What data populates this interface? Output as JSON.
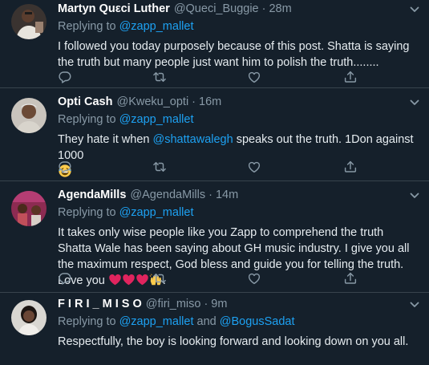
{
  "colors": {
    "background": "#15202b",
    "divider": "#38444d",
    "muted": "#8899a6",
    "link": "#1da1f2",
    "heart": "#e0245e"
  },
  "icons": {
    "actions": [
      "reply-icon",
      "retweet-icon",
      "like-icon",
      "share-icon"
    ],
    "menu": "chevron-down-icon"
  },
  "tweets": [
    {
      "name": "Martyn Quεci Luther",
      "handle": "@Queci_Buggie",
      "time": "28m",
      "replying_prefix": "Replying to",
      "reply_to_1": "@zapp_mallet",
      "text": "I followed you today purposely because of this post. Shatta is saying the truth but many people just want him to polish the truth........"
    },
    {
      "name": "Opti Cash",
      "handle": "@Kweku_opti",
      "time": "16m",
      "replying_prefix": "Replying to",
      "reply_to_1": "@zapp_mallet",
      "text_before": "They hate it when ",
      "mention": "@shattawalegh",
      "text_after": " speaks out the truth. 1Don against 1000",
      "emoji": "tears-of-joy-emoji"
    },
    {
      "name": "AgendaMills",
      "handle": "@AgendaMills",
      "time": "14m",
      "replying_prefix": "Replying to",
      "reply_to_1": "@zapp_mallet",
      "text": "It takes only wise people like you Zapp to comprehend the truth Shatta Wale has been saying about GH music industry. I give you all the maximum respect, God bless and guide you for telling the truth. Love you",
      "emojis": [
        "red-heart-emoji",
        "red-heart-emoji",
        "red-heart-emoji",
        "raising-hands-emoji"
      ],
      "text_end": "."
    },
    {
      "name": "F I R I _ M I S O",
      "handle": "@firi_miso",
      "time": "9m",
      "replying_prefix": "Replying to",
      "reply_to_1": "@zapp_mallet",
      "and_word": "and",
      "reply_to_2": "@BogusSadat",
      "text": "Respectfully, the boy is looking forward and looking down on you all."
    }
  ]
}
